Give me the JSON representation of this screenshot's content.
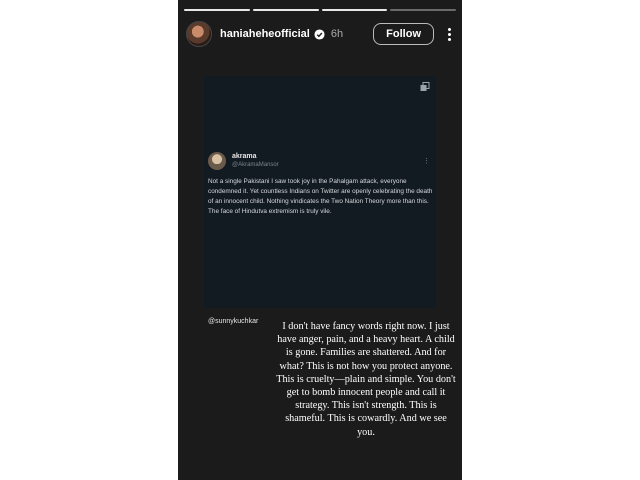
{
  "story": {
    "username": "haniaheheofficial",
    "time": "6h",
    "follow_label": "Follow",
    "segments_total": 4,
    "segments_done": 3
  },
  "tweet": {
    "name": "akrama",
    "handle": "@AkramaMansor",
    "text": "Not a single Pakistani I saw took joy in the Pahalgam attack, everyone condemned it. Yet countless Indians on Twitter are openly celebrating the death of an innocent child. Nothing vindicates the Two Nation Theory more than this. The face of Hindutva extremism is truly vile."
  },
  "mention": "@sunnykuchkar",
  "caption": "I don't have fancy words right now. I just have anger, pain, and a heavy heart. A child is gone. Families are shattered. And for what? This is not how you protect anyone. This is cruelty—plain and simple. You don't get to bomb innocent people and call it strategy. This isn't strength. This is shameful. This is cowardly. And we see you.",
  "icons": {
    "verified": "verified-badge-icon",
    "more": "more-vertical-icon",
    "copy": "copy-icon",
    "tweet_more": "more-horizontal-icon"
  },
  "colors": {
    "story_bg": "#1b1b1b",
    "card_bg": "#121a22",
    "verified": "#3897f0"
  }
}
